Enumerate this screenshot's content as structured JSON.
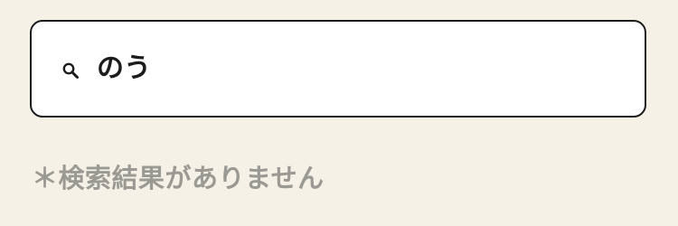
{
  "search": {
    "value": "のう",
    "icon": "search-icon"
  },
  "results": {
    "empty_message": "＊検索結果がありません"
  },
  "colors": {
    "background": "#f5f1e6",
    "border": "#1c1c1c",
    "message": "#9b9993"
  }
}
